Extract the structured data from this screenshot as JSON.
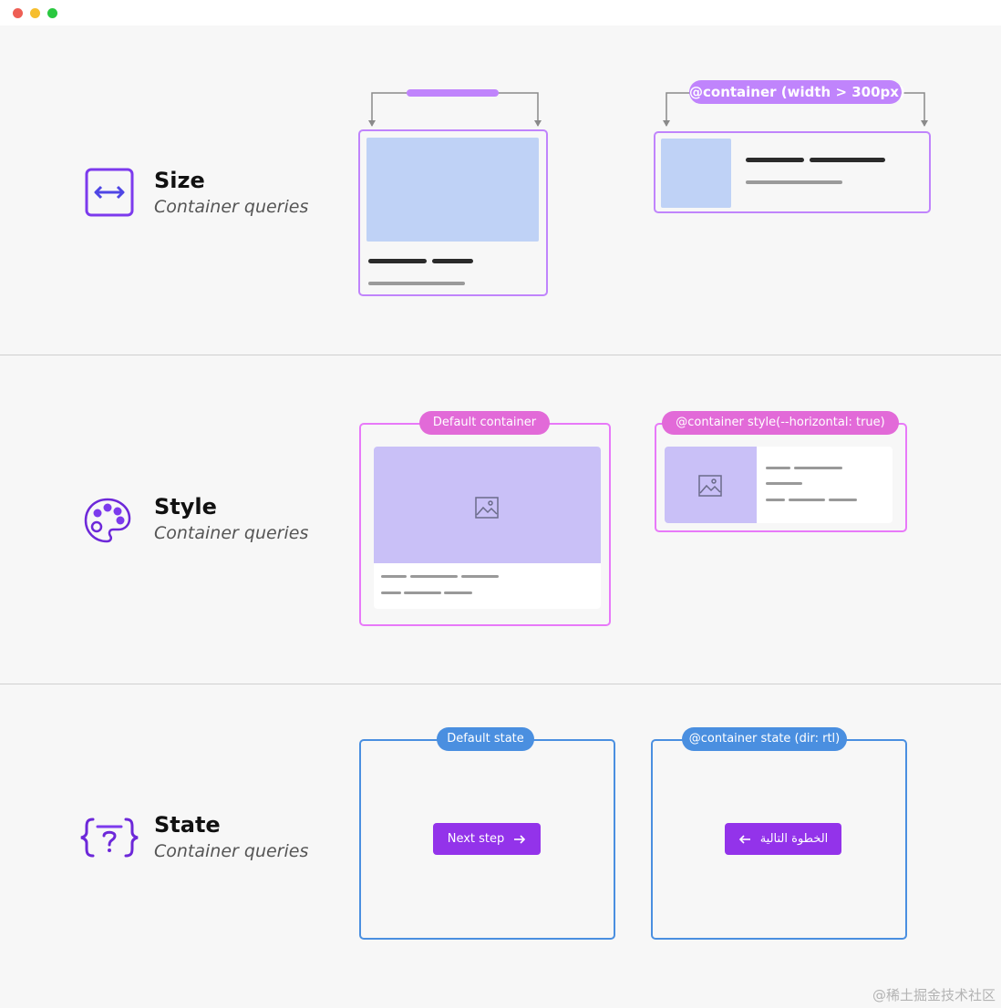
{
  "window": {
    "dots": {
      "red": "#ee5f55",
      "yellow": "#f6be2f",
      "green": "#2ac840"
    }
  },
  "sections": {
    "size": {
      "title": "Size",
      "subtitle": "Container queries",
      "icon": "resize-arrows-icon",
      "query_label": "@container  (width > 300px)"
    },
    "style": {
      "title": "Style",
      "subtitle": "Container queries",
      "icon": "palette-icon",
      "default_label": "Default container",
      "query_label": "@container style(--horizontal: true)"
    },
    "state": {
      "title": "State",
      "subtitle": "Container queries",
      "icon": "curly-braces-question-icon",
      "default_label": "Default state",
      "query_label": "@container state (dir: rtl)",
      "default_button": "Next step",
      "rtl_button": "الخطوة التالية"
    }
  },
  "watermark": "@稀土掘金技术社区",
  "colors": {
    "purple": "#9333ea",
    "size_border": "#c084fc",
    "size_pill": "#c084fc",
    "style_border": "#e879f9",
    "style_pill": "#e26ad8",
    "state_border": "#4a8fe0",
    "state_pill": "#4a8fe0",
    "image_blue": "#bfd2f6",
    "image_lavender": "#c9c0f7"
  }
}
